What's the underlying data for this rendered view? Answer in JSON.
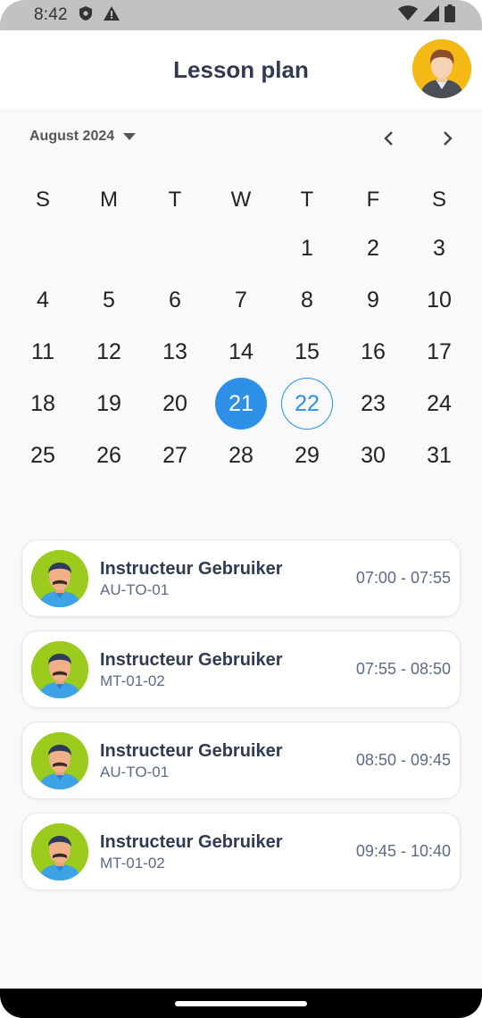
{
  "status_bar": {
    "time": "8:42",
    "left_icons": [
      "shield-icon",
      "warning-icon"
    ],
    "right_icons": [
      "wifi-icon",
      "signal-icon",
      "battery-icon"
    ]
  },
  "header": {
    "title": "Lesson plan",
    "avatar_icon": "user-avatar-icon"
  },
  "calendar": {
    "month_label": "August 2024",
    "prev_icon": "chevron-left-icon",
    "next_icon": "chevron-right-icon",
    "weekdays": [
      "S",
      "M",
      "T",
      "W",
      "T",
      "F",
      "S"
    ],
    "weeks": [
      [
        "",
        "",
        "",
        "",
        "1",
        "2",
        "3"
      ],
      [
        "4",
        "5",
        "6",
        "7",
        "8",
        "9",
        "10"
      ],
      [
        "11",
        "12",
        "13",
        "14",
        "15",
        "16",
        "17"
      ],
      [
        "18",
        "19",
        "20",
        "21",
        "22",
        "23",
        "24"
      ],
      [
        "25",
        "26",
        "27",
        "28",
        "29",
        "30",
        "31"
      ]
    ],
    "selected_day": "21",
    "today_day": "22",
    "accent_color": "#2d8fe5"
  },
  "lessons": [
    {
      "name": "Instructeur Gebruiker",
      "code": "AU-TO-01",
      "time": "07:00 - 07:55"
    },
    {
      "name": "Instructeur Gebruiker",
      "code": "MT-01-02",
      "time": "07:55 - 08:50"
    },
    {
      "name": "Instructeur Gebruiker",
      "code": "AU-TO-01",
      "time": "08:50 - 09:45"
    },
    {
      "name": "Instructeur Gebruiker",
      "code": "MT-01-02",
      "time": "09:45 - 10:40"
    }
  ]
}
